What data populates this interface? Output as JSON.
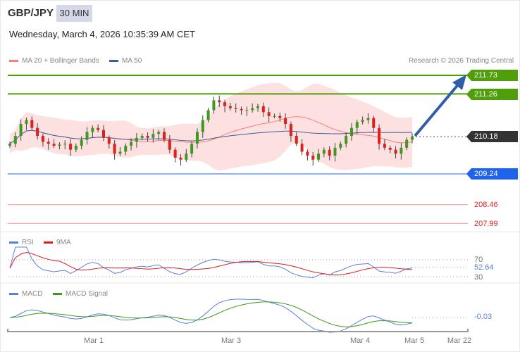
{
  "header": {
    "symbol": "GBP/JPY",
    "timeframe": "30 MIN",
    "datetime": "Wednesday, March 4, 2026 10:35:39 AM CET",
    "copyright": "Research © 2026 Trading Central"
  },
  "legend": {
    "ma20": "MA 20 + Bollinger Bands",
    "ma50": "MA 50",
    "rsi": "RSI",
    "rsi_ma": "9MA",
    "macd": "MACD",
    "macd_signal": "MACD Signal"
  },
  "colors": {
    "ma20": "#ff7b7b",
    "ma50": "#3a5f9a",
    "band": "#fde0e0",
    "up": "#3d9a1a",
    "down": "#e0201c",
    "resistance": "#4f9e0a",
    "pivot": "#1e62f0",
    "support": "#f25050",
    "last": "#333333",
    "arrow": "#2f5ea8"
  },
  "levels": {
    "resistance2": "211.73",
    "resistance1": "211.26",
    "last": "210.18",
    "pivot": "209.24",
    "support1": "208.46",
    "support2": "207.99"
  },
  "rsi_panel": {
    "upper": "70",
    "lower": "30",
    "value": "52.64"
  },
  "macd_panel": {
    "value": "-0.03"
  },
  "xaxis": [
    "Mar 1",
    "Mar 3",
    "Mar 4",
    "Mar 5",
    "Mar 22"
  ],
  "chart_data": {
    "type": "candlestick",
    "symbol": "GBP/JPY",
    "interval": "30 MIN",
    "closes": [
      210.0,
      210.2,
      210.5,
      210.6,
      210.4,
      210.2,
      210.05,
      210.0,
      209.95,
      209.98,
      210.0,
      209.85,
      209.95,
      210.1,
      210.3,
      210.4,
      210.35,
      210.15,
      210.0,
      209.75,
      209.8,
      209.95,
      210.05,
      210.15,
      210.2,
      210.15,
      210.25,
      210.3,
      210.1,
      209.85,
      209.65,
      209.6,
      209.75,
      210.0,
      210.3,
      210.6,
      210.85,
      211.1,
      211.05,
      210.95,
      210.9,
      210.88,
      210.85,
      210.85,
      210.9,
      210.95,
      210.8,
      210.7,
      210.7,
      210.65,
      210.5,
      210.2,
      210.0,
      209.8,
      209.7,
      209.6,
      209.75,
      209.85,
      209.7,
      209.9,
      210.0,
      210.2,
      210.4,
      210.55,
      210.6,
      210.65,
      210.4,
      210.0,
      209.9,
      209.85,
      209.75,
      209.9,
      210.1,
      210.18
    ],
    "ylim": [
      207.8,
      212.0
    ],
    "target": 211.73
  }
}
